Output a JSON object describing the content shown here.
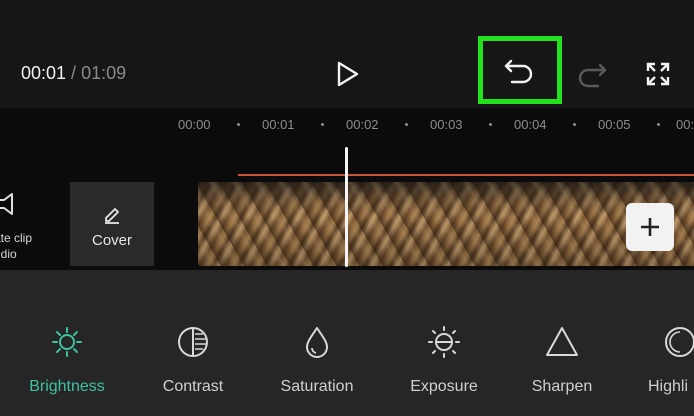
{
  "header": {
    "current_time": "00:01",
    "separator": " / ",
    "duration": "01:09"
  },
  "ruler": {
    "ticks": [
      "00:00",
      "00:01",
      "00:02",
      "00:03",
      "00:04",
      "00:05",
      "00:0"
    ]
  },
  "track": {
    "mute_label_line1": "ate clip",
    "mute_label_line2": "udio",
    "cover_label": "Cover"
  },
  "tools": {
    "items": [
      {
        "label": "Brightness",
        "icon": "sun-icon",
        "active": true
      },
      {
        "label": "Contrast",
        "icon": "contrast-icon",
        "active": false
      },
      {
        "label": "Saturation",
        "icon": "droplet-icon",
        "active": false
      },
      {
        "label": "Exposure",
        "icon": "exposure-icon",
        "active": false
      },
      {
        "label": "Sharpen",
        "icon": "triangle-icon",
        "active": false
      },
      {
        "label": "Highli",
        "icon": "circle-icon",
        "active": false
      }
    ]
  },
  "colors": {
    "highlight_box": "#22e21f",
    "active_tool": "#3ec1a2",
    "audio_line": "#c6543a"
  }
}
